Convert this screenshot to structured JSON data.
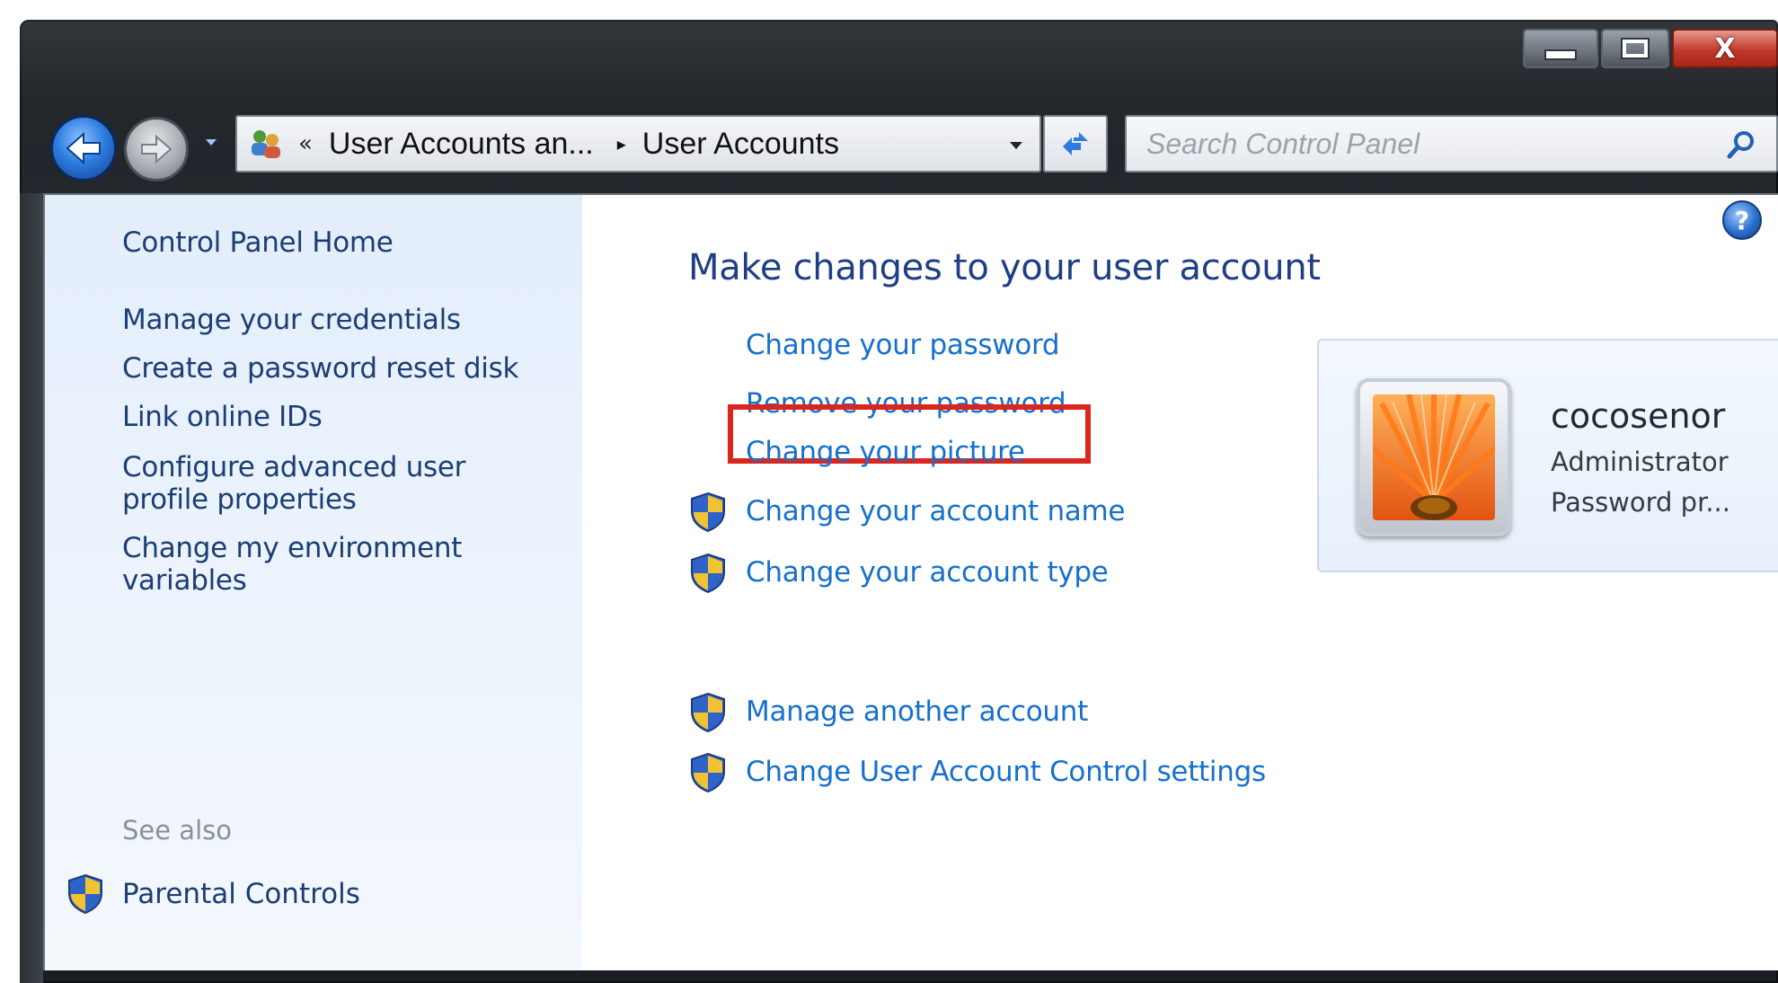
{
  "window": {
    "caption": {
      "minimize": "",
      "maximize": "",
      "close": "X"
    }
  },
  "addressbar": {
    "overflow_chevron": "«",
    "crumbs": [
      "User Accounts an...",
      "User Accounts"
    ],
    "separator": "▸"
  },
  "search": {
    "placeholder": "Search Control Panel"
  },
  "help": {
    "label": "?"
  },
  "sidebar": {
    "items": [
      {
        "label": "Control Panel Home"
      },
      {
        "label": "Manage your credentials"
      },
      {
        "label": "Create a password reset disk"
      },
      {
        "label": "Link online IDs"
      },
      {
        "label_line1": "Configure advanced user",
        "label_line2": "profile properties"
      },
      {
        "label_line1": "Change my environment",
        "label_line2": "variables"
      }
    ],
    "see_also": "See also",
    "parental_controls": "Parental Controls"
  },
  "main": {
    "heading": "Make changes to your user account",
    "tasks": [
      {
        "label": "Change your password",
        "shield": false
      },
      {
        "label": "Remove your password",
        "shield": false,
        "highlighted": true
      },
      {
        "label": "Change your picture",
        "shield": false
      },
      {
        "label": "Change your account name",
        "shield": true
      },
      {
        "label": "Change your account type",
        "shield": true
      },
      {
        "label": "Manage another account",
        "shield": true
      },
      {
        "label": "Change User Account Control settings",
        "shield": true
      }
    ]
  },
  "account": {
    "name": "cocosenor",
    "type": "Administrator",
    "password_status": "Password pr..."
  },
  "colors": {
    "link": "#1670cc",
    "heading": "#1e3f86",
    "highlight_box": "#d9261e",
    "sidebar_link": "#1b3e74"
  }
}
